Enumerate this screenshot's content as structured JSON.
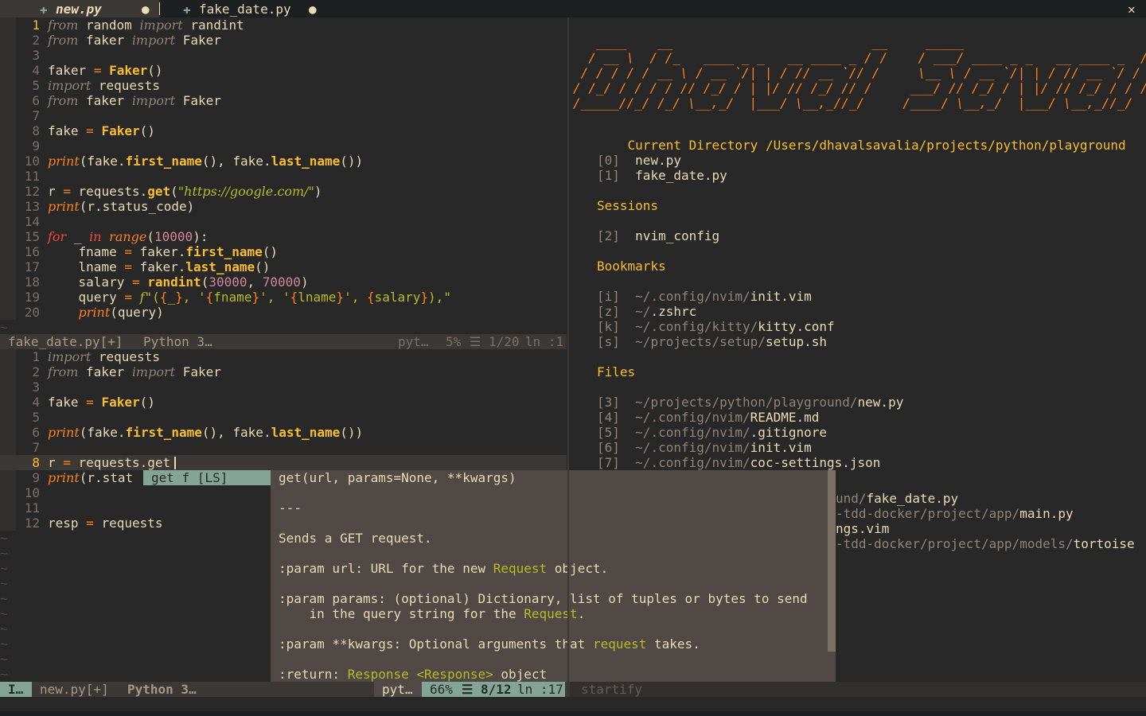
{
  "tabs": [
    {
      "name": "new.py",
      "modified_marker": "●",
      "active": true
    },
    {
      "name": "fake_date.py",
      "modified_marker": "●",
      "active": false
    }
  ],
  "close_symbol": "✕",
  "top_pane": {
    "lines": [
      {
        "n": "1",
        "html": "<span class='kwg'>from</span> random <span class='kwg'>import</span> randint"
      },
      {
        "n": "2",
        "html": "<span class='kwg'>from</span> faker <span class='kwg'>import</span> Faker"
      },
      {
        "n": "3",
        "html": ""
      },
      {
        "n": "4",
        "html": "faker <span class='op'>=</span> <span class='fn'>Faker</span>()"
      },
      {
        "n": "5",
        "html": "<span class='kwg'>import</span> requests"
      },
      {
        "n": "6",
        "html": "<span class='kwg'>from</span> faker <span class='kwg'>import</span> Faker"
      },
      {
        "n": "7",
        "html": ""
      },
      {
        "n": "8",
        "html": "fake <span class='op'>=</span> <span class='fn'>Faker</span>()"
      },
      {
        "n": "9",
        "html": ""
      },
      {
        "n": "10",
        "html": "<span class='bi'>print</span>(fake.<span class='fn'>first_name</span>(), fake.<span class='fn'>last_name</span>())"
      },
      {
        "n": "11",
        "html": ""
      },
      {
        "n": "12",
        "html": "r <span class='op'>=</span> requests.<span class='fn'>get</span>(<span class='str'>\"https://google.com/\"</span>)"
      },
      {
        "n": "13",
        "html": "<span class='bi'>print</span>(r.status_code)"
      },
      {
        "n": "14",
        "html": ""
      },
      {
        "n": "15",
        "html": "<span class='kw'>for</span> _ <span class='kw'>in</span> <span class='bi'>range</span>(<span class='num'>10000</span>):"
      },
      {
        "n": "16",
        "html": "    fname <span class='op'>=</span> faker.<span class='fn'>first_name</span>()"
      },
      {
        "n": "17",
        "html": "    lname <span class='op'>=</span> faker.<span class='fn'>last_name</span>()"
      },
      {
        "n": "18",
        "html": "    salary <span class='op'>=</span> <span class='fn'>randint</span>(<span class='num'>30000</span>, <span class='num'>70000</span>)"
      },
      {
        "n": "19",
        "html": "    query <span class='op'>=</span> <span class='str'>f</span><span class='fstr'>\"(<span class='brace'>{</span>_<span class='brace'>}</span>, '<span class='brace'>{</span>fname<span class='brace'>}</span>', '<span class='brace'>{</span>lname<span class='brace'>}</span>', <span class='brace'>{</span>salary<span class='brace'>}</span>),\"</span>"
      },
      {
        "n": "20",
        "html": "    <span class='bi'>print</span>(query)"
      }
    ],
    "status": {
      "file": "fake_date.py[+]",
      "lang": "Python 3…",
      "ft": "pyt…",
      "percent": "5%",
      "pos": "☰ 1/20",
      "col": "ln :1"
    }
  },
  "bottom_pane": {
    "lines": [
      {
        "n": "1",
        "html": "<span class='kwg'>import</span> requests"
      },
      {
        "n": "2",
        "html": "<span class='kwg'>from</span> faker <span class='kwg'>import</span> Faker"
      },
      {
        "n": "3",
        "html": ""
      },
      {
        "n": "4",
        "html": "fake <span class='op'>=</span> <span class='fn'>Faker</span>()"
      },
      {
        "n": "5",
        "html": ""
      },
      {
        "n": "6",
        "html": "<span class='bi'>print</span>(fake.<span class='fn'>first_name</span>(), fake.<span class='fn'>last_name</span>())"
      },
      {
        "n": "7",
        "html": ""
      },
      {
        "n": "8",
        "html": "r <span class='op'>=</span> requests.get"
      },
      {
        "n": "9",
        "html": "<span class='bi'>print</span>(r.stat"
      },
      {
        "n": "10",
        "html": ""
      },
      {
        "n": "11",
        "html": ""
      },
      {
        "n": "12",
        "html": "resp <span class='op'>=</span> requests"
      }
    ]
  },
  "completion": {
    "item": "get f [LS]"
  },
  "doc_popup": {
    "lines": [
      "get(url, params=None, **kwargs)",
      "",
      "---",
      "",
      "Sends a GET request.",
      "",
      ":param url: URL for the new <span class='green'>Request</span> object.",
      "",
      ":param params: (optional) Dictionary, list of tuples or bytes to send",
      "    in the query string for the <span class='green'>Request</span>.",
      "",
      ":param **kwargs: Optional arguments that <span class='green'>request</span> takes.",
      "",
      ":return: <span class='green'>Response</span> <span class='green'>&lt;Response&gt;</span> object"
    ]
  },
  "startify": {
    "banner": [
      "   ____    __                          __     _____                          __",
      "  / __ \\  / /_   ____ _ _   __ ____ _ / /    / ___/ ____ _ _   __ ____ _  / /",
      " / / / / / __ \\ / __ `/| | / // __ `// /     \\__ \\ / __ `/| | / // __ `/ / / ",
      "/ /_/ / / / / // /_/ / | |/ // /_/ // /     ___/ // /_/ / | |/ // /_/ / / /  ",
      "/_____//_/ /_/ \\__,_/  |___/ \\__,_//_/     /____/ \\__,_/  |___/ \\__,_//_/   "
    ],
    "current_dir_label": "Current Directory",
    "current_dir": "/Users/dhavalsavalia/projects/python/playground",
    "dir_files": [
      {
        "key": "[0]",
        "name": "new.py"
      },
      {
        "key": "[1]",
        "name": "fake_date.py"
      }
    ],
    "sessions_label": "Sessions",
    "sessions": [
      {
        "key": "[2]",
        "name": "nvim_config"
      }
    ],
    "bookmarks_label": "Bookmarks",
    "bookmarks": [
      {
        "key": "[i]",
        "dir": "~/.config/nvim/",
        "file": "init.vim"
      },
      {
        "key": "[z]",
        "dir": "~/",
        "file": ".zshrc"
      },
      {
        "key": "[k]",
        "dir": "~/.config/kitty/",
        "file": "kitty.conf"
      },
      {
        "key": "[s]",
        "dir": "~/projects/setup/",
        "file": "setup.sh"
      }
    ],
    "files_label": "Files",
    "files": [
      {
        "key": "[3]",
        "dir": "~/projects/python/playground/",
        "file": "new.py"
      },
      {
        "key": "[4]",
        "dir": "~/.config/nvim/",
        "file": "README.md"
      },
      {
        "key": "[5]",
        "dir": "~/.config/nvim/",
        "file": ".gitignore"
      },
      {
        "key": "[6]",
        "dir": "~/.config/nvim/",
        "file": "init.vim"
      },
      {
        "key": "[7]",
        "dir": "~/.config/nvim/",
        "file": "coc-settings.json"
      }
    ],
    "files_partial": [
      {
        "dir": "und/",
        "file": "fake_date.py"
      },
      {
        "dir": "-tdd-docker/project/app/",
        "file": "main.py"
      },
      {
        "dir": "",
        "file": "ngs.vim"
      },
      {
        "dir": "-tdd-docker/project/app/models/",
        "file": "tortoise"
      }
    ]
  },
  "statusline": {
    "mode": "I…",
    "file": "new.py[+]",
    "lang": "Python 3…",
    "ft": "pyt…",
    "percent": "66%",
    "pos": "☰ 8/12",
    "col": "ln :17",
    "right_pane": "startify"
  }
}
